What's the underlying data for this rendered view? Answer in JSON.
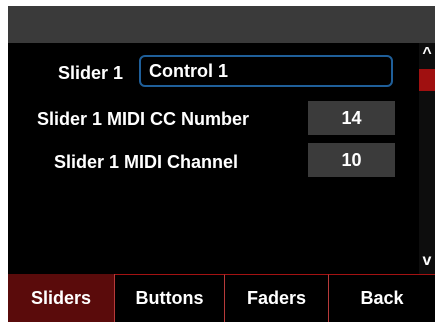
{
  "scrollbar": {
    "up_glyph": "^",
    "down_glyph": "v"
  },
  "fields": {
    "name_label": "Slider 1",
    "name_value": "Control 1",
    "cc_label": "Slider 1 MIDI CC Number",
    "cc_value": "14",
    "channel_label": "Slider 1 MIDI Channel",
    "channel_value": "10"
  },
  "tabs": [
    {
      "label": "Sliders",
      "active": true
    },
    {
      "label": "Buttons",
      "active": false
    },
    {
      "label": "Faders",
      "active": false
    },
    {
      "label": "Back",
      "active": false
    }
  ],
  "colors": {
    "accent_red": "#a31212",
    "active_tab": "#5a0b0b",
    "input_border": "#1f5f9a",
    "value_box": "#3b3b3b"
  }
}
